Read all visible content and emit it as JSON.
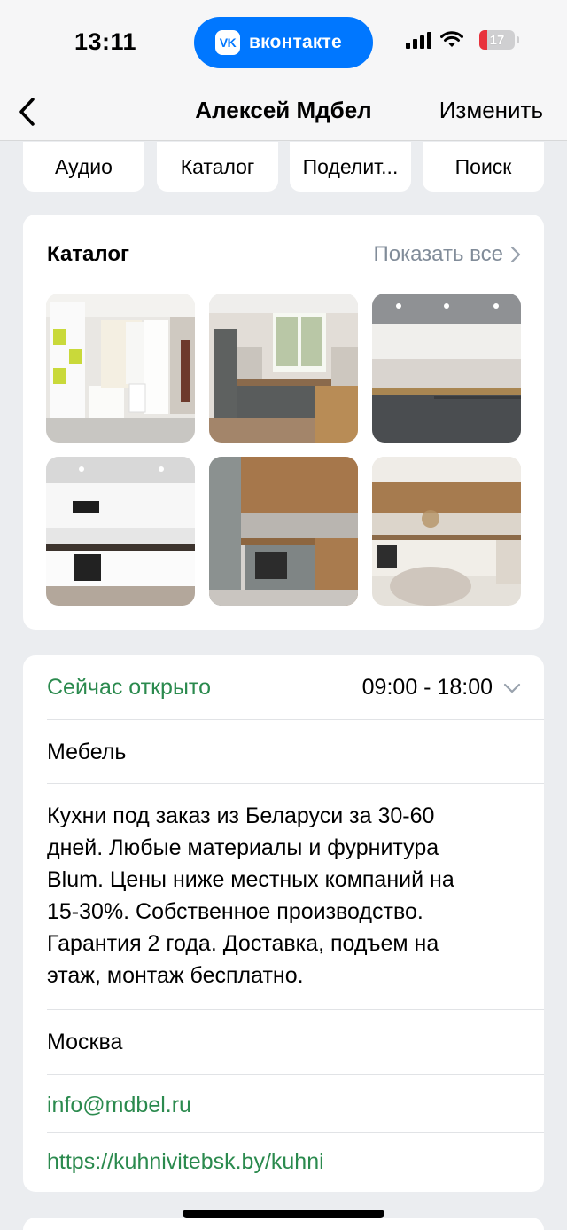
{
  "status_bar": {
    "time": "13:11",
    "app_pill": "вконтакте",
    "app_pill_logo": "VK",
    "battery": "17",
    "accent_color": "#0077ff"
  },
  "nav": {
    "title": "Алексей Мдбел",
    "edit_label": "Изменить"
  },
  "actions": [
    {
      "label": "Аудио"
    },
    {
      "label": "Каталог"
    },
    {
      "label": "Поделит..."
    },
    {
      "label": "Поиск"
    }
  ],
  "catalog": {
    "title": "Каталог",
    "show_all": "Показать все",
    "thumbs": [
      {
        "icon": "product-photo-white-wardrobe"
      },
      {
        "icon": "product-photo-gray-kitchen"
      },
      {
        "icon": "product-photo-dark-kitchen"
      },
      {
        "icon": "product-photo-white-kitchen"
      },
      {
        "icon": "product-photo-wood-kitchen"
      },
      {
        "icon": "product-photo-wood-beige-kitchen"
      }
    ]
  },
  "info": {
    "status": "Сейчас открыто",
    "hours": "09:00 - 18:00",
    "category": "Мебель",
    "description_lines": [
      "Кухни под заказ из Беларуси за 30-60",
      "дней. Любые материалы и фурнитура",
      "Blum. Цены ниже местных компаний на",
      "15-30%. Собственное производство.",
      "Гарантия 2 года. Доставка, подъем на",
      "этаж, монтаж бесплатно."
    ],
    "city": "Москва",
    "email": "info@mdbel.ru",
    "website": "https://kuhnivitebsk.by/kuhni",
    "status_color": "#2b8a4e"
  }
}
